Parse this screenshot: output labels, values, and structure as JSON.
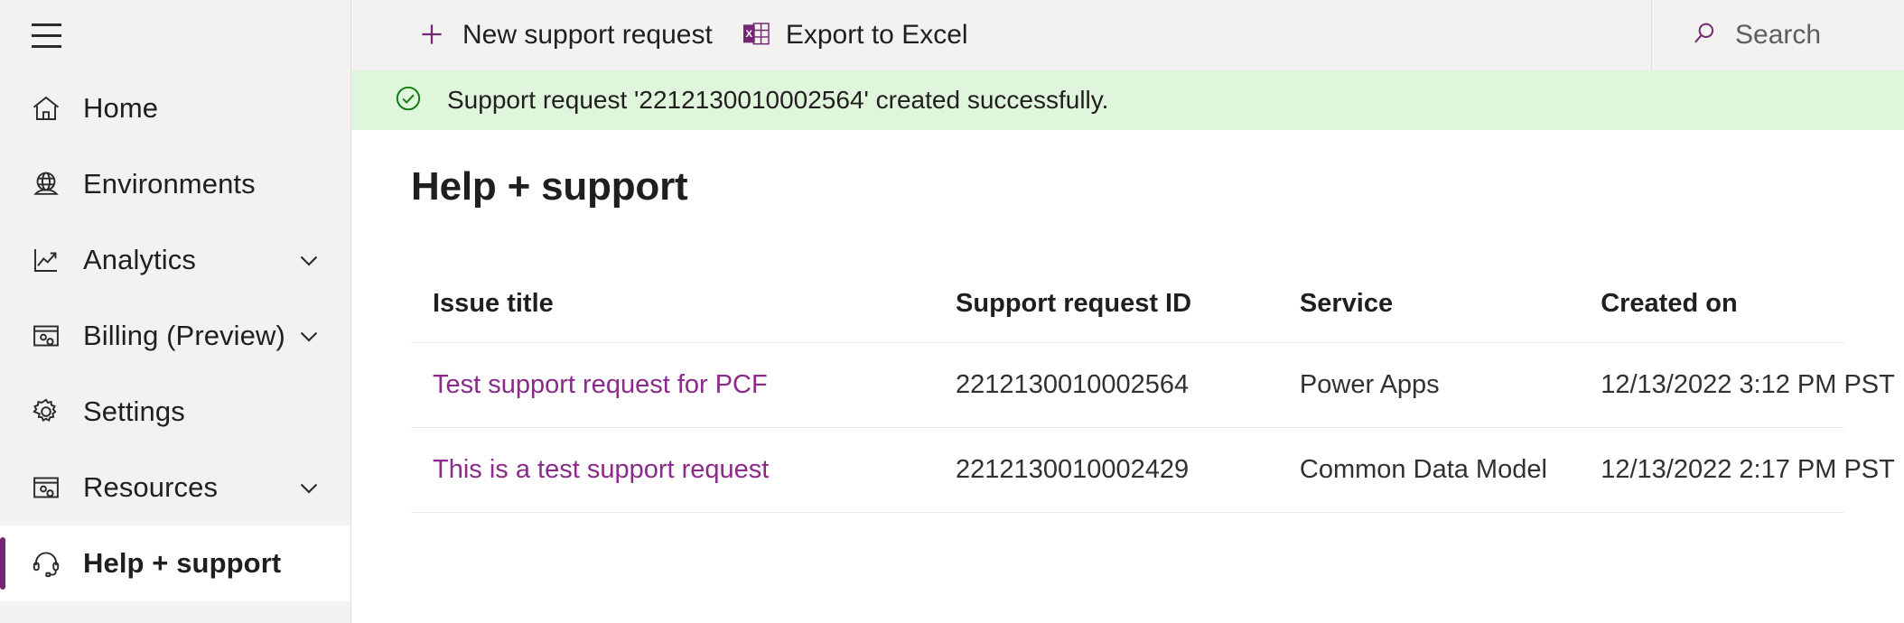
{
  "sidebar": {
    "menu_button": "hamburger-menu",
    "items": [
      {
        "label": "Home",
        "icon": "home-icon",
        "expandable": false,
        "selected": false
      },
      {
        "label": "Environments",
        "icon": "globe-icon",
        "expandable": false,
        "selected": false
      },
      {
        "label": "Analytics",
        "icon": "chart-line-icon",
        "expandable": true,
        "selected": false
      },
      {
        "label": "Billing (Preview)",
        "icon": "billing-icon",
        "expandable": true,
        "selected": false
      },
      {
        "label": "Settings",
        "icon": "gear-icon",
        "expandable": false,
        "selected": false
      },
      {
        "label": "Resources",
        "icon": "resources-icon",
        "expandable": true,
        "selected": false
      },
      {
        "label": "Help + support",
        "icon": "headset-icon",
        "expandable": false,
        "selected": true
      }
    ]
  },
  "command_bar": {
    "new_request_label": "New support request",
    "export_label": "Export to Excel"
  },
  "search": {
    "placeholder": "Search"
  },
  "notification": {
    "text": "Support request '2212130010002564' created successfully.",
    "icon": "success-check-icon",
    "background": "#dff6dd",
    "icon_color": "#107c10"
  },
  "page": {
    "title": "Help + support"
  },
  "table": {
    "columns": [
      "Issue title",
      "Support request ID",
      "Service",
      "Created on"
    ],
    "rows": [
      {
        "issue_title": "Test support request for PCF",
        "support_request_id": "2212130010002564",
        "service": "Power Apps",
        "created_on": "12/13/2022 3:12 PM PST"
      },
      {
        "issue_title": "This is a test support request",
        "support_request_id": "2212130010002429",
        "service": "Common Data Model",
        "created_on": "12/13/2022 2:17 PM PST"
      }
    ]
  },
  "colors": {
    "accent_purple": "#742774",
    "link_purple": "#8a2a8a",
    "sidebar_bg": "#f3f2f1",
    "success_green": "#107c10"
  }
}
